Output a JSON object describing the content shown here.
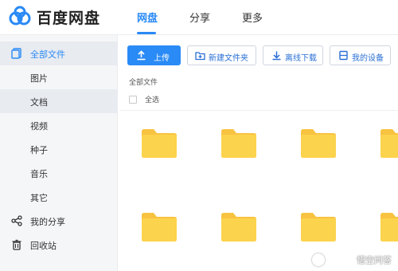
{
  "app": {
    "brand": "百度网盘"
  },
  "nav": {
    "tabs": [
      {
        "label": "网盘"
      },
      {
        "label": "分享"
      },
      {
        "label": "更多"
      }
    ]
  },
  "sidebar": {
    "items": [
      {
        "label": "全部文件"
      },
      {
        "label": "图片"
      },
      {
        "label": "文档"
      },
      {
        "label": "视频"
      },
      {
        "label": "种子"
      },
      {
        "label": "音乐"
      },
      {
        "label": "其它"
      },
      {
        "label": "我的分享"
      },
      {
        "label": "回收站"
      }
    ]
  },
  "toolbar": {
    "upload": "上传",
    "new_folder": "新建文件夹",
    "offline_download": "离线下载",
    "my_devices": "我的设备"
  },
  "breadcrumb": "全部文件",
  "select_all": "全选",
  "watermark": "悟空问答",
  "colors": {
    "accent": "#2a8af6",
    "folder": "#fcd34d",
    "folder_tab": "#f8c341"
  }
}
